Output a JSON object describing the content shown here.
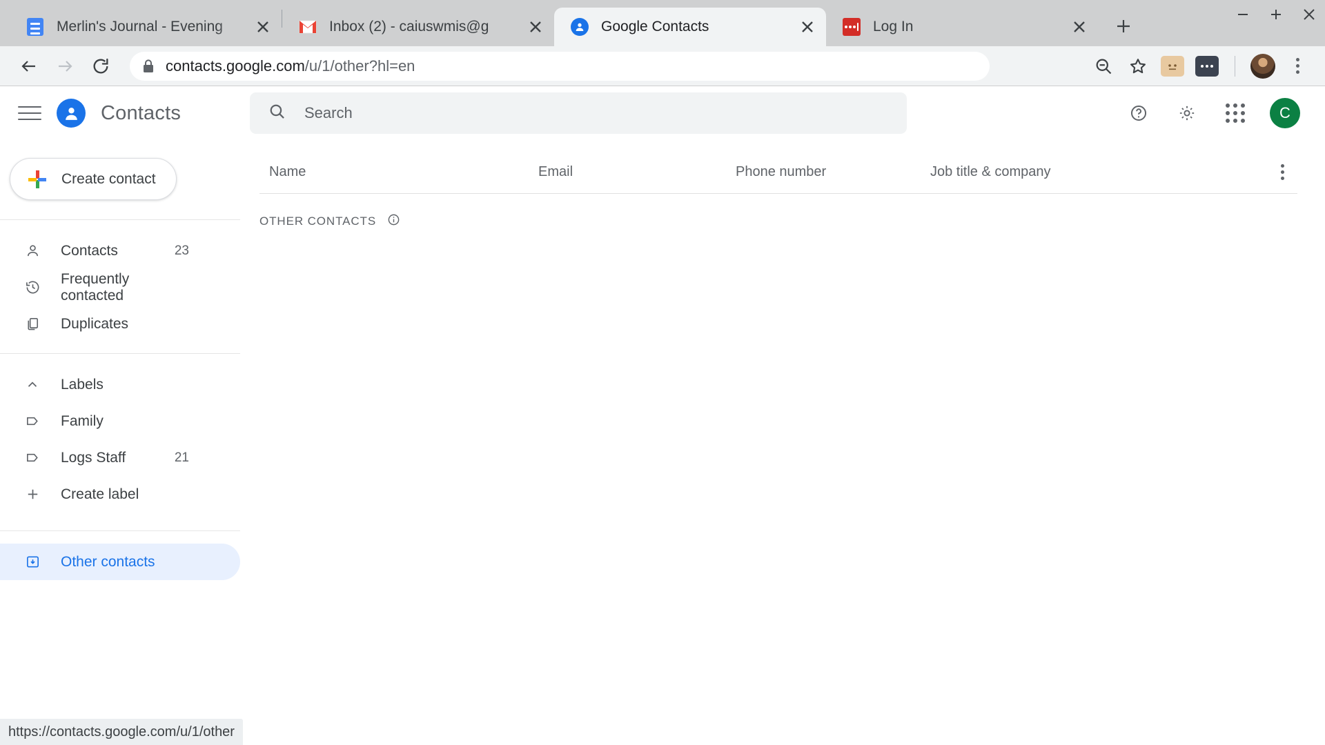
{
  "browser": {
    "tabs": [
      {
        "title": "Merlin's Journal - Evening",
        "favicon": "docs-icon",
        "active": false
      },
      {
        "title": "Inbox (2) - caiuswmis@g",
        "favicon": "gmail-icon",
        "active": false
      },
      {
        "title": "Google Contacts",
        "favicon": "contacts-icon",
        "active": true
      },
      {
        "title": "Log In",
        "favicon": "lastpass-icon",
        "active": false
      }
    ],
    "new_tab_label": "+",
    "window_controls": {
      "minimize": "–",
      "maximize": "+",
      "close": "✕"
    },
    "omnibox": {
      "domain": "contacts.google.com",
      "path": "/u/1/other?hl=en",
      "lock_icon": "lock-icon"
    },
    "toolbar_icons": [
      "zoom-out-icon",
      "bookmark-star-icon",
      "extension-puzzle-icon",
      "extension-dots-icon",
      "profile-avatar",
      "chrome-menu-icon"
    ],
    "status_bar_url": "https://contacts.google.com/u/1/other"
  },
  "app": {
    "brand_title": "Contacts",
    "create_contact_label": "Create contact",
    "sidebar": {
      "primary": [
        {
          "label": "Contacts",
          "count": "23",
          "icon": "person-icon",
          "selected": false
        },
        {
          "label": "Frequently contacted",
          "count": "",
          "icon": "history-icon",
          "selected": false
        },
        {
          "label": "Duplicates",
          "count": "",
          "icon": "duplicates-icon",
          "selected": false
        }
      ],
      "labels_header": "Labels",
      "labels": [
        {
          "label": "Family",
          "count": "",
          "icon": "label-tag-icon",
          "selected": false
        },
        {
          "label": "Logs Staff",
          "count": "21",
          "icon": "label-tag-icon",
          "selected": false
        },
        {
          "label": "Create label",
          "count": "",
          "icon": "plus-icon",
          "selected": false
        }
      ],
      "other": [
        {
          "label": "Other contacts",
          "count": "",
          "icon": "other-contacts-icon",
          "selected": true
        }
      ]
    },
    "search": {
      "placeholder": "Search",
      "value": "",
      "icon": "search-icon"
    },
    "header_actions": {
      "help": "help-icon",
      "settings": "gear-icon",
      "apps": "apps-grid-icon",
      "account_initial": "C"
    },
    "table": {
      "columns": [
        "Name",
        "Email",
        "Phone number",
        "Job title & company"
      ],
      "more_icon": "more-vert-icon",
      "rows": []
    },
    "group": {
      "label": "OTHER CONTACTS",
      "info_icon": "info-icon"
    }
  },
  "colors": {
    "accent_blue": "#1a73e8",
    "selected_bg": "#e8f0fe",
    "chrome_bg": "#cfd0d1",
    "toolbar_bg": "#f1f3f4",
    "avatar_green": "#0b8043"
  }
}
